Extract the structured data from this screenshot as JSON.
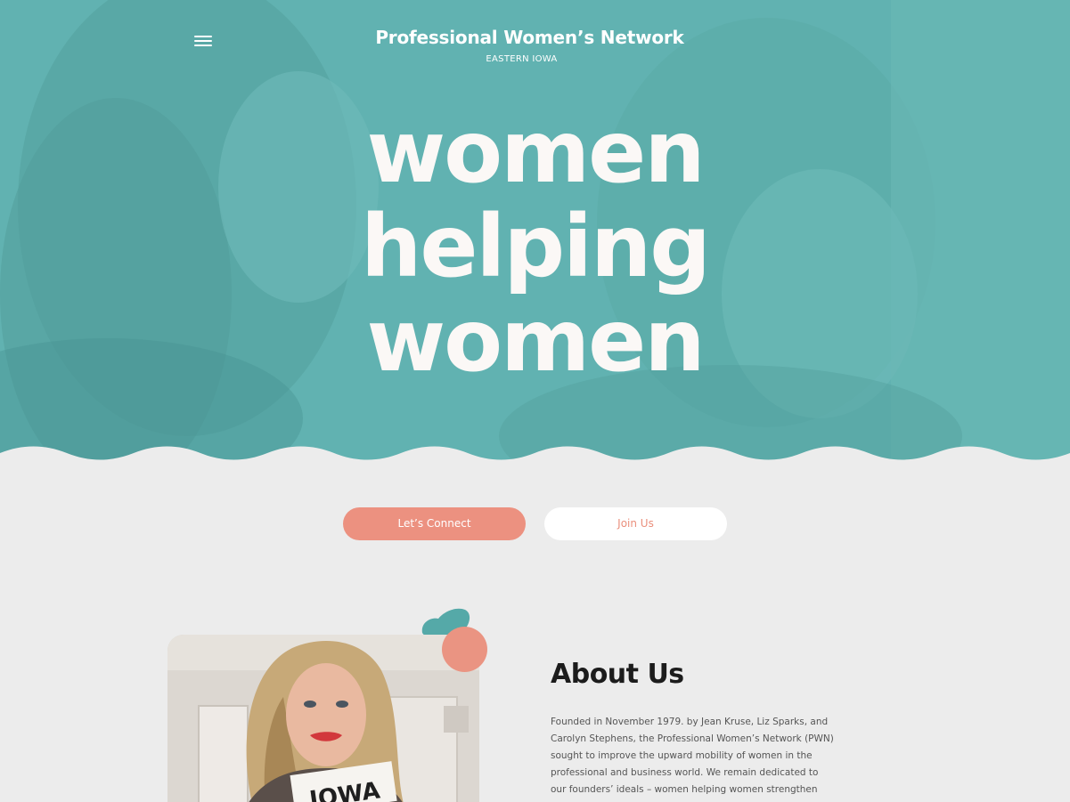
{
  "header": {
    "title": "Professional Women’s Network",
    "subtitle": "EASTERN IOWA",
    "menu_icon": "hamburger-menu-icon"
  },
  "hero": {
    "headline_lines": [
      "women",
      "helping",
      "women"
    ],
    "background_color": "#61b1b0"
  },
  "cta": {
    "connect_label": "Let’s Connect",
    "join_label": "Join Us",
    "accent_color": "#ec9180"
  },
  "about": {
    "title": "About Us",
    "body": "Founded in November 1979. by Jean Kruse, Liz Sparks, and Carolyn Stephens, the Professional Women’s Network (PWN) sought to improve the upward mobility of women in the professional and business world. We remain dedicated to our founders’ ideals – women helping women strengthen professions, develop networks,",
    "photo_sign_text": "IOWA"
  }
}
